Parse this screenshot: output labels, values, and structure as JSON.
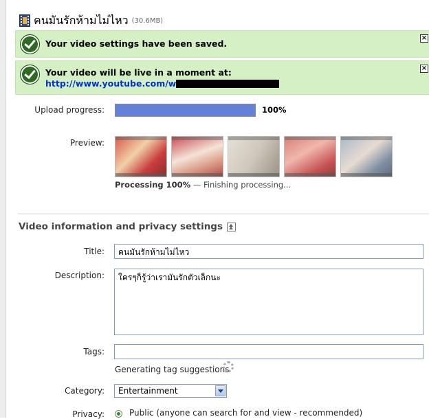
{
  "file": {
    "title": "คนมันรักห้ามไม่ไหว",
    "size": "(30.6MB)"
  },
  "notices": {
    "saved": "Your video settings have been saved.",
    "live_text": "Your video will be live in a moment at:",
    "live_url": "http://www.youtube.com/w",
    "close_glyph": "×"
  },
  "upload": {
    "label": "Upload progress:",
    "percent_text": "100%",
    "progress": 1.0
  },
  "preview": {
    "label": "Preview:",
    "processing_bold": "Processing 100%",
    "processing_rest": " — Finishing processing..."
  },
  "section": {
    "title": "Video information and privacy settings"
  },
  "form": {
    "title_label": "Title:",
    "title_value": "คนมันรักห้ามไม่ไหว",
    "description_label": "Description:",
    "description_value": "ใครๆก็รู้ว่าเรามันรักตัวเล็กนะ",
    "tags_label": "Tags:",
    "tags_value": "",
    "tags_status": "Generating tag suggestions",
    "category_label": "Category:",
    "category_value": "Entertainment",
    "privacy_label": "Privacy:",
    "privacy_option": "Public (anyone can search for and view - recommended)"
  },
  "colors": {
    "notice_bg": "#d5f0c4",
    "progress_fill": "#6381d8",
    "link": "#0033cc"
  },
  "icons": [
    "film-icon",
    "check-icon",
    "close-icon",
    "collapse-icon",
    "spinner-icon",
    "chevron-down-icon",
    "radio-icon"
  ]
}
